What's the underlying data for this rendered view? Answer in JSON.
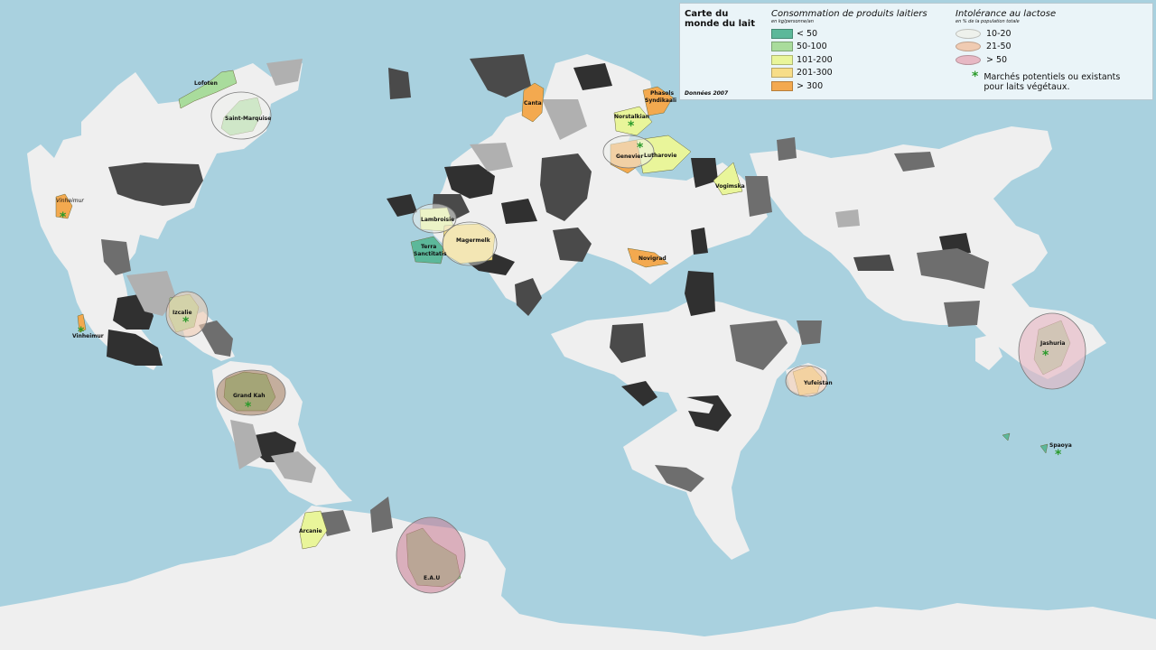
{
  "legend": {
    "title": "Carte du monde du lait",
    "source": "Données 2007",
    "consumption": {
      "heading": "Consommation de produits laitiers",
      "unit": "en kg/personne/an",
      "classes": [
        {
          "label": "< 50",
          "color": "#5cb89a"
        },
        {
          "label": "50-100",
          "color": "#a9dc9c"
        },
        {
          "label": "101-200",
          "color": "#e9f59a"
        },
        {
          "label": "201-300",
          "color": "#f7dd88"
        },
        {
          "label": "> 300",
          "color": "#f3a94f"
        }
      ]
    },
    "intolerance": {
      "heading": "Intolérance au lactose",
      "unit": "en % de la population totale",
      "classes": [
        {
          "label": "10-20",
          "color": "#eef1ec"
        },
        {
          "label": "21-50",
          "color": "#f0cbb2"
        },
        {
          "label": "> 50",
          "color": "#e7b8c4"
        }
      ],
      "marker_note": "Marchés potentiels ou existants pour laits végétaux.",
      "marker_symbol": "*"
    }
  },
  "regions": {
    "lofoten": "Lofoten",
    "saint_marquise": "Saint-Marquise",
    "vinheimur_north": "Vinheimur",
    "vinheimur_south": "Vinheimur",
    "izcalie": "Izcalie",
    "grand_kah": "Grand Kah",
    "arcanie": "Arcanie",
    "eau": "E.A.U",
    "lambroisie": "Lambroisie",
    "terra_sanctitatis": "Terra Sanctitatis",
    "magermelk": "Magermelk",
    "canta": "Canta",
    "phasols": "Phasols",
    "syndikaali": "Syndikaali",
    "norstalkian": "Norstalkian",
    "genevier": "Genevier",
    "lutharovie": "Lutharovie",
    "vogimska": "Vogimska",
    "novigrad": "Novigrad",
    "yufeistan": "Yufeistan",
    "jashuria": "Jashuria",
    "spaoya": "Spaoya"
  },
  "colors": {
    "ocean": "#a9d1df",
    "land": "#efefef",
    "no_data_dark": "#303030",
    "no_data_mid": "#6e6e6e",
    "no_data_light": "#b0b0b0",
    "marker": "#2a9a2a"
  }
}
